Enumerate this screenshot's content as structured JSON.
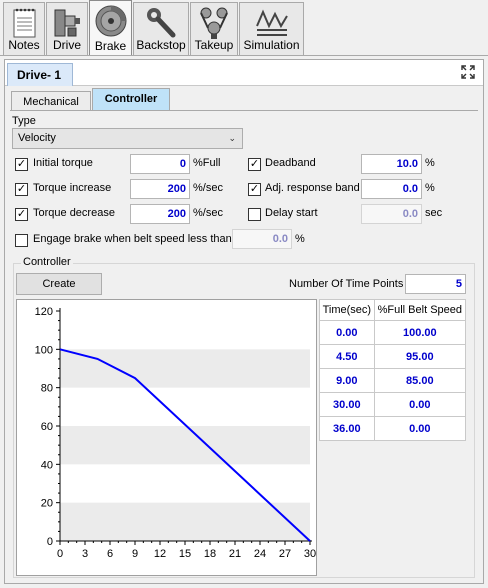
{
  "toolbar": {
    "tabs": [
      {
        "label": "Notes",
        "icon": "notepad-icon",
        "active": false
      },
      {
        "label": "Drive",
        "icon": "drive-motor-icon",
        "active": false
      },
      {
        "label": "Brake",
        "icon": "brake-disc-icon",
        "active": true
      },
      {
        "label": "Backstop",
        "icon": "wrench-icon",
        "active": false
      },
      {
        "label": "Takeup",
        "icon": "takeup-pulley-icon",
        "active": false
      },
      {
        "label": "Simulation",
        "icon": "simulation-icon",
        "active": false
      }
    ]
  },
  "window": {
    "tab_label": "Drive- 1",
    "subtabs": [
      {
        "label": "Mechanical",
        "active": false
      },
      {
        "label": "Controller",
        "active": true
      }
    ]
  },
  "controller": {
    "type_label": "Type",
    "type_value": "Velocity",
    "initial_torque": {
      "label": "Initial torque",
      "checked": true,
      "value": "0",
      "unit": "%Full"
    },
    "torque_increase": {
      "label": "Torque increase",
      "checked": true,
      "value": "200",
      "unit": "%/sec"
    },
    "torque_decrease": {
      "label": "Torque decrease",
      "checked": true,
      "value": "200",
      "unit": "%/sec"
    },
    "deadband": {
      "label": "Deadband",
      "checked": true,
      "value": "10.0",
      "unit": "%"
    },
    "adj_response_band": {
      "label": "Adj. response band",
      "checked": true,
      "value": "0.0",
      "unit": "%"
    },
    "delay_start": {
      "label": "Delay start",
      "checked": false,
      "value": "0.0",
      "unit": "sec"
    },
    "engage_brake": {
      "label": "Engage brake when belt speed less than",
      "checked": false,
      "value": "0.0",
      "unit": "%"
    },
    "group_title": "Controller",
    "create_button": "Create",
    "num_points_label": "Number Of Time Points",
    "num_points_value": "5"
  },
  "table": {
    "headers": [
      "Time(sec)",
      "%Full Belt Speed"
    ],
    "rows": [
      [
        "0.00",
        "100.00"
      ],
      [
        "4.50",
        "95.00"
      ],
      [
        "9.00",
        "85.00"
      ],
      [
        "30.00",
        "0.00"
      ],
      [
        "36.00",
        "0.00"
      ]
    ]
  },
  "chart_data": {
    "type": "line",
    "title": "",
    "xlabel": "",
    "ylabel": "",
    "xlim": [
      0,
      30
    ],
    "ylim": [
      0,
      120
    ],
    "x_ticks": [
      "0",
      "3",
      "6",
      "9",
      "12",
      "15",
      "18",
      "21",
      "24",
      "27",
      "30"
    ],
    "y_ticks": [
      "0",
      "20",
      "40",
      "60",
      "80",
      "100",
      "120"
    ],
    "series": [
      {
        "x": [
          0,
          4.5,
          9,
          30
        ],
        "y": [
          100,
          95,
          85,
          0
        ],
        "color": "#0000ff"
      }
    ],
    "grid": "alternating horizontal bands",
    "band_color": "#ebebeb"
  }
}
